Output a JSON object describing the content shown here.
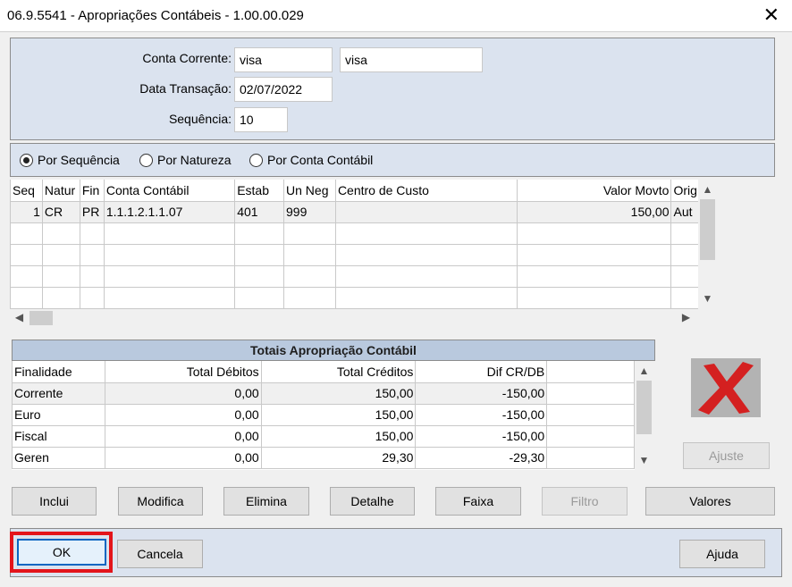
{
  "window": {
    "title": "06.9.5541 - Apropriações Contábeis - 1.00.00.029",
    "close_glyph": "✕"
  },
  "form": {
    "conta_corrente_label": "Conta Corrente:",
    "conta_corrente_value": "visa",
    "conta_corrente_desc": "visa",
    "data_transacao_label": "Data Transação:",
    "data_transacao_value": "02/07/2022",
    "sequencia_label": "Sequência:",
    "sequencia_value": "10"
  },
  "sort_options": [
    {
      "label": "Por Sequência",
      "selected": true
    },
    {
      "label": "Por Natureza",
      "selected": false
    },
    {
      "label": "Por Conta Contábil",
      "selected": false
    }
  ],
  "grid": {
    "columns": [
      "Seq",
      "Natur",
      "Fin",
      "Conta Contábil",
      "Estab",
      "Un Neg",
      "Centro de Custo",
      "Valor Movto",
      "Orig"
    ],
    "rows": [
      [
        "1",
        "CR",
        "PR",
        "1.1.1.2.1.1.07",
        "401",
        "999",
        "",
        "150,00",
        "Aut"
      ],
      [
        "",
        "",
        "",
        "",
        "",
        "",
        "",
        "",
        ""
      ],
      [
        "",
        "",
        "",
        "",
        "",
        "",
        "",
        "",
        ""
      ],
      [
        "",
        "",
        "",
        "",
        "",
        "",
        "",
        "",
        ""
      ],
      [
        "",
        "",
        "",
        "",
        "",
        "",
        "",
        "",
        ""
      ]
    ]
  },
  "totals": {
    "title": "Totais Apropriação Contábil",
    "columns": [
      "Finalidade",
      "Total Débitos",
      "Total Créditos",
      "Dif CR/DB"
    ],
    "rows": [
      [
        "Corrente",
        "0,00",
        "150,00",
        "-150,00"
      ],
      [
        "Euro",
        "0,00",
        "150,00",
        "-150,00"
      ],
      [
        "Fiscal",
        "0,00",
        "150,00",
        "-150,00"
      ],
      [
        "Geren",
        "0,00",
        "29,30",
        "-29,30"
      ]
    ]
  },
  "buttons": {
    "ajuste": "Ajuste",
    "inclui": "Inclui",
    "modifica": "Modifica",
    "elimina": "Elimina",
    "detalhe": "Detalhe",
    "faixa": "Faixa",
    "filtro": "Filtro",
    "valores": "Valores",
    "ok": "OK",
    "cancela": "Cancela",
    "ajuda": "Ajuda"
  },
  "icons": {
    "delete_icon": "red-x-icon",
    "colors": {
      "highlight": "#e3141b",
      "x_red": "#d42020",
      "panel_bg": "#dbe3ef",
      "header_bg": "#b9c9de"
    }
  }
}
